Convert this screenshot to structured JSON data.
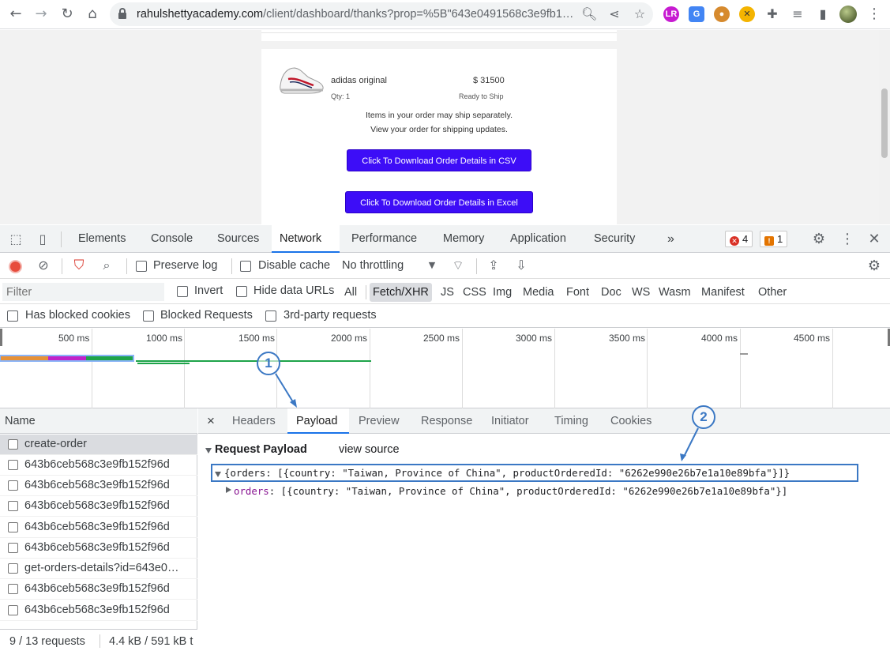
{
  "browser": {
    "url_host": "rahulshettyacademy.com",
    "url_path": "/client/dashboard/thanks?prop=%5B\"643e0491568c3e9fb1…",
    "icons": [
      "back-icon",
      "forward-icon",
      "reload-icon",
      "home-icon",
      "lock-icon",
      "zoom-icon",
      "share-icon",
      "star-icon",
      "extensions-icon",
      "reading-list-icon",
      "side-panel-icon",
      "menu-icon"
    ]
  },
  "page": {
    "product_name": "adidas original",
    "product_price": "$ 31500",
    "qty": "Qty: 1",
    "ship_status": "Ready to Ship",
    "note_line1": "Items in your order may ship separately.",
    "note_line2": "View your order for shipping updates.",
    "btn_csv": "Click To Download Order Details in CSV",
    "btn_excel": "Click To Download Order Details in Excel"
  },
  "devtools": {
    "tabs": [
      "Elements",
      "Console",
      "Sources",
      "Network",
      "Performance",
      "Memory",
      "Application",
      "Security"
    ],
    "active_tab": "Network",
    "more_tabs": "»",
    "errors_count": "4",
    "warnings_count": "1",
    "toolbar": {
      "preserve_log": "Preserve log",
      "disable_cache": "Disable cache",
      "throttling": "No throttling"
    },
    "filter": {
      "placeholder": "Filter",
      "invert": "Invert",
      "hide_data_urls": "Hide data URLs",
      "types": [
        "All",
        "Fetch/XHR",
        "JS",
        "CSS",
        "Img",
        "Media",
        "Font",
        "Doc",
        "WS",
        "Wasm",
        "Manifest",
        "Other"
      ],
      "active_type": "Fetch/XHR",
      "blocked_cookies": "Has blocked cookies",
      "blocked_requests": "Blocked Requests",
      "third_party": "3rd-party requests"
    },
    "timeline_ticks": [
      "500 ms",
      "1000 ms",
      "1500 ms",
      "2000 ms",
      "2500 ms",
      "3000 ms",
      "3500 ms",
      "4000 ms",
      "4500 ms"
    ],
    "name_header": "Name",
    "requests": [
      "create-order",
      "643b6ceb568c3e9fb152f96d",
      "643b6ceb568c3e9fb152f96d",
      "643b6ceb568c3e9fb152f96d",
      "643b6ceb568c3e9fb152f96d",
      "643b6ceb568c3e9fb152f96d",
      "get-orders-details?id=643e0…",
      "643b6ceb568c3e9fb152f96d",
      "643b6ceb568c3e9fb152f96d"
    ],
    "status_requests": "9 / 13 requests",
    "status_size": "4.4 kB / 591 kB t",
    "detail_close": "×",
    "detail_tabs": [
      "Headers",
      "Payload",
      "Preview",
      "Response",
      "Initiator",
      "Timing",
      "Cookies"
    ],
    "active_detail_tab": "Payload",
    "payload_title": "Request Payload",
    "view_source": "view source",
    "payload_line1": "{orders: [{country: \"Taiwan, Province of China\", productOrderedId: \"6262e990e26b7e1a10e89bfa\"}]}",
    "payload_key": "orders",
    "payload_line2_rest": ": [{country: \"Taiwan, Province of China\", productOrderedId: \"6262e990e26b7e1a10e89bfa\"}]"
  },
  "annotations": [
    "1",
    "2"
  ],
  "colors": {
    "accent": "#1a73e8",
    "download_button": "#3d0df7",
    "annotation": "#3b78c4",
    "record": "#e74c3c",
    "filter_active": "#d93025"
  }
}
